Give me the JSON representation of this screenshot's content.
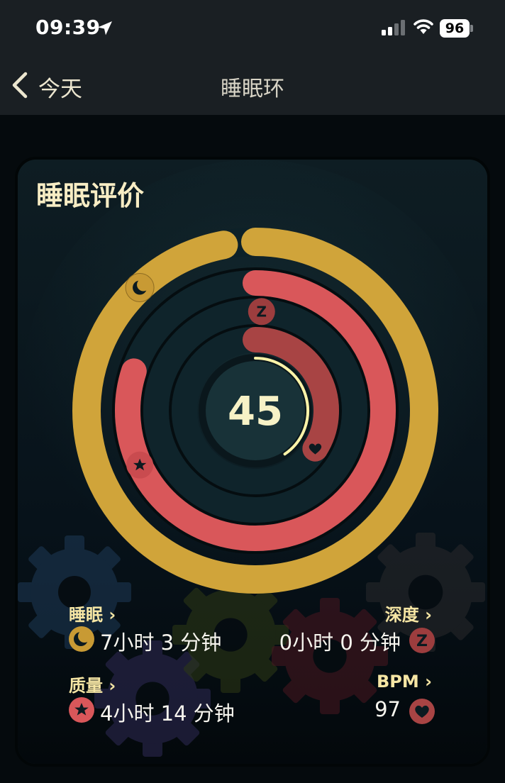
{
  "status_bar": {
    "time": "09:39",
    "battery": "96",
    "icons": [
      "location-arrow-icon",
      "cellular-signal-icon",
      "wifi-icon",
      "battery-icon"
    ]
  },
  "nav": {
    "back_label": "今天",
    "title": "睡眠环"
  },
  "card": {
    "title": "睡眠评价",
    "score": "45",
    "score_fraction": 0.45,
    "rings": {
      "outer_sleep_fraction": 0.97,
      "quality_fraction": 0.8,
      "depth_fraction": 0.0,
      "bpm_fraction": 0.34
    },
    "ring_icons": [
      "moon-icon",
      "star-icon",
      "z-icon",
      "heart-icon"
    ],
    "stats": {
      "sleep": {
        "label": "睡眠 ›",
        "value": "7小时 3 分钟",
        "icon": "moon-icon"
      },
      "depth": {
        "label": "深度 ›",
        "value": "0小时 0 分钟",
        "icon": "z-icon"
      },
      "quality": {
        "label": "质量 ›",
        "value": "4小时 14 分钟",
        "icon": "star-icon"
      },
      "bpm": {
        "label": "BPM ›",
        "value": "97",
        "icon": "heart-icon"
      }
    }
  },
  "colors": {
    "gold": "#d0a43a",
    "red": "#d9575a",
    "dark_red": "#a84444",
    "score_arc": "#fbf3a8",
    "label": "#f6e6a4"
  }
}
